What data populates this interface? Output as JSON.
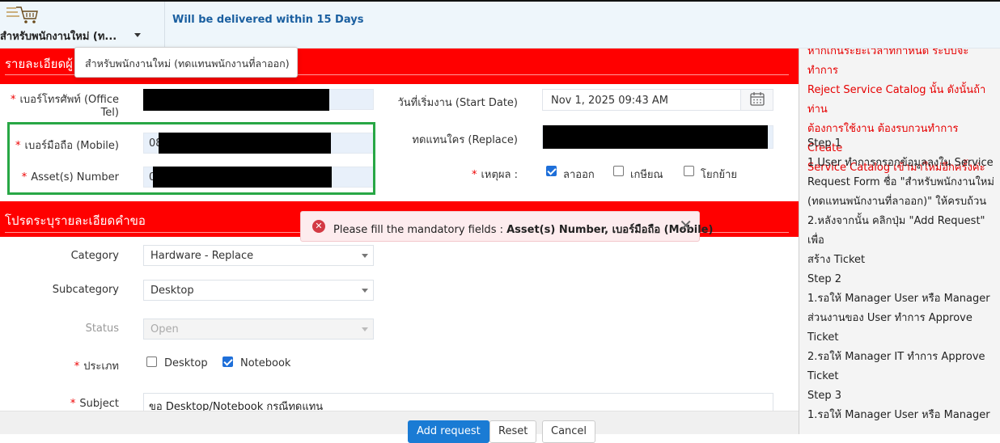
{
  "header": {
    "catalog_label": "สำหรับพนักงานใหม่ (ท...",
    "delivery_text": "Will be delivered within 15 Days"
  },
  "tooltip": {
    "text": "สำหรับพนักงานใหม่ (ทดแทนพนักงานที่ลาออก)"
  },
  "section1": {
    "title": "รายละเอียดผู้"
  },
  "section2": {
    "title": "โปรดระบุรายละเอียดคำขอ"
  },
  "fields": {
    "office_tel_label_1": "เบอร์โทรศัพท์ (Office",
    "office_tel_label_2": "Tel)",
    "mobile_label": "เบอร์มือถือ (Mobile)",
    "mobile_value": "08",
    "asset_label": "Asset(s) Number",
    "asset_value": "0",
    "start_date_label": "วันที่เริ่มงาน (Start Date)",
    "start_date_value": "Nov 1, 2025 09:43 AM",
    "replace_label": "ทดแทนใคร (Replace)",
    "reason_label": "เหตุผล :",
    "reason_options": [
      {
        "label": "ลาออก",
        "checked": true
      },
      {
        "label": "เกษียณ",
        "checked": false
      },
      {
        "label": "โยกย้าย",
        "checked": false
      }
    ],
    "category_label": "Category",
    "category_value": "Hardware - Replace",
    "subcategory_label": "Subcategory",
    "subcategory_value": "Desktop",
    "status_label": "Status",
    "status_value": "Open",
    "type_label": "ประเภท",
    "type_options": [
      {
        "label": "Desktop",
        "checked": false
      },
      {
        "label": "Notebook",
        "checked": true
      }
    ],
    "subject_label": "Subject",
    "subject_value": "ขอ Desktop/Notebook กรณีทดแทน"
  },
  "toast": {
    "message_prefix": "Please fill the mandatory fields : ",
    "message_fields": "Asset(s) Number, เบอร์มือถือ (Mobile)",
    "close_symbol": "✕",
    "icon_symbol": "✕"
  },
  "buttons": {
    "add": "Add request",
    "reset": "Reset",
    "cancel": "Cancel"
  },
  "sidebar": {
    "red_lines": [
      "หากเกินระยะเวลาที่กำหนด ระบบจะทำการ",
      "Reject Service Catalog นั้น ดังนั้นถ้าท่าน",
      "ต้องการใช้งาน ต้องรบกวนทำการ Create",
      "Service Catalog เข้ามาใหม่อีกครั้งค่ะ"
    ],
    "step1_title": "Step 1",
    "step1_lines": [
      "1.User ทำการกรอกข้อมูลลงใน Service",
      "Request Form ชื่อ \"สำหรับพนักงานใหม่",
      "(ทดแทนพนักงานที่ลาออก)\" ให้ครบถ้วน",
      "2.หลังจากนั้น คลิกปุ่ม \"Add Request\" เพื่อ",
      "สร้าง Ticket"
    ],
    "step2_title": "Step 2",
    "step2_lines": [
      "1.รอให้ Manager User หรือ Manager",
      "ส่วนงานของ User ทำการ Approve Ticket",
      "2.รอให้ Manager IT ทำการ Approve",
      "Ticket"
    ],
    "step3_title": "Step 3",
    "step3_lines": [
      "1.รอให้ Manager User หรือ Manager"
    ]
  },
  "colors": {
    "section_red": "#ff0000",
    "accent_blue": "#1a7bd4",
    "highlight_green": "#28a745"
  }
}
